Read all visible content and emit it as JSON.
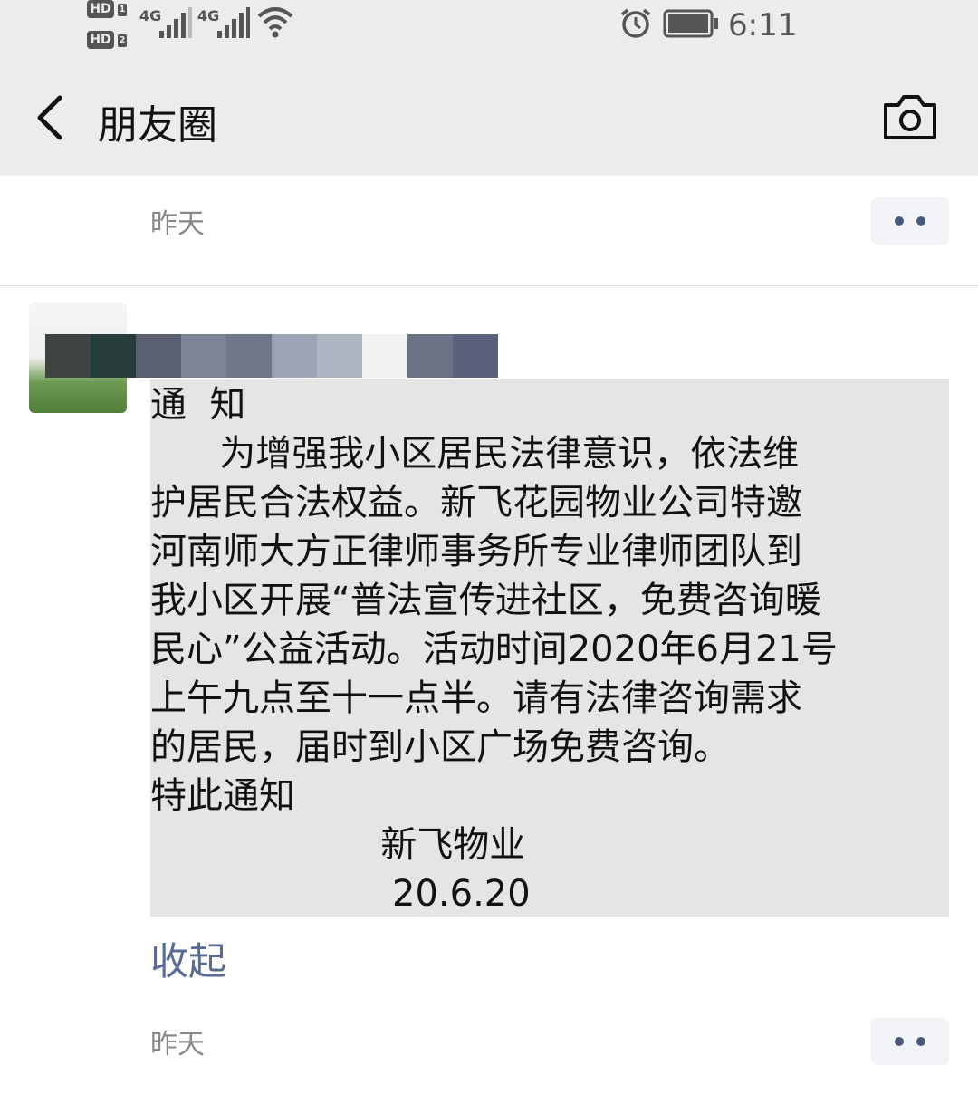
{
  "status_bar": {
    "hd1": "HD",
    "hd1_sub": "1",
    "hd2": "HD",
    "hd2_sub": "2",
    "signal1": "4G",
    "signal2": "4G",
    "time": "6:11"
  },
  "nav": {
    "title": "朋友圈"
  },
  "posts": [
    {
      "timestamp": "昨天"
    },
    {
      "timestamp": "昨天"
    }
  ],
  "notice": {
    "lines": [
      "通  知",
      "      为增强我小区居民法律意识，依法维",
      "护居民合法权益。新飞花园物业公司特邀",
      "河南师大方正律师事务所专业律师团队到",
      "我小区开展“普法宣传进社区，免费咨询暖",
      "民心”公益活动。活动时间2020年6月21号",
      "上午九点至十一点半。请有法律咨询需求",
      "的居民，届时到小区广场免费咨询。",
      "特此通知",
      "                    新飞物业",
      "                     20.6.20"
    ]
  },
  "collapse_label": "收起",
  "colors": {
    "link": "#576b95",
    "content_bg": "#e5e5e5",
    "topbar_bg": "#ececec"
  }
}
